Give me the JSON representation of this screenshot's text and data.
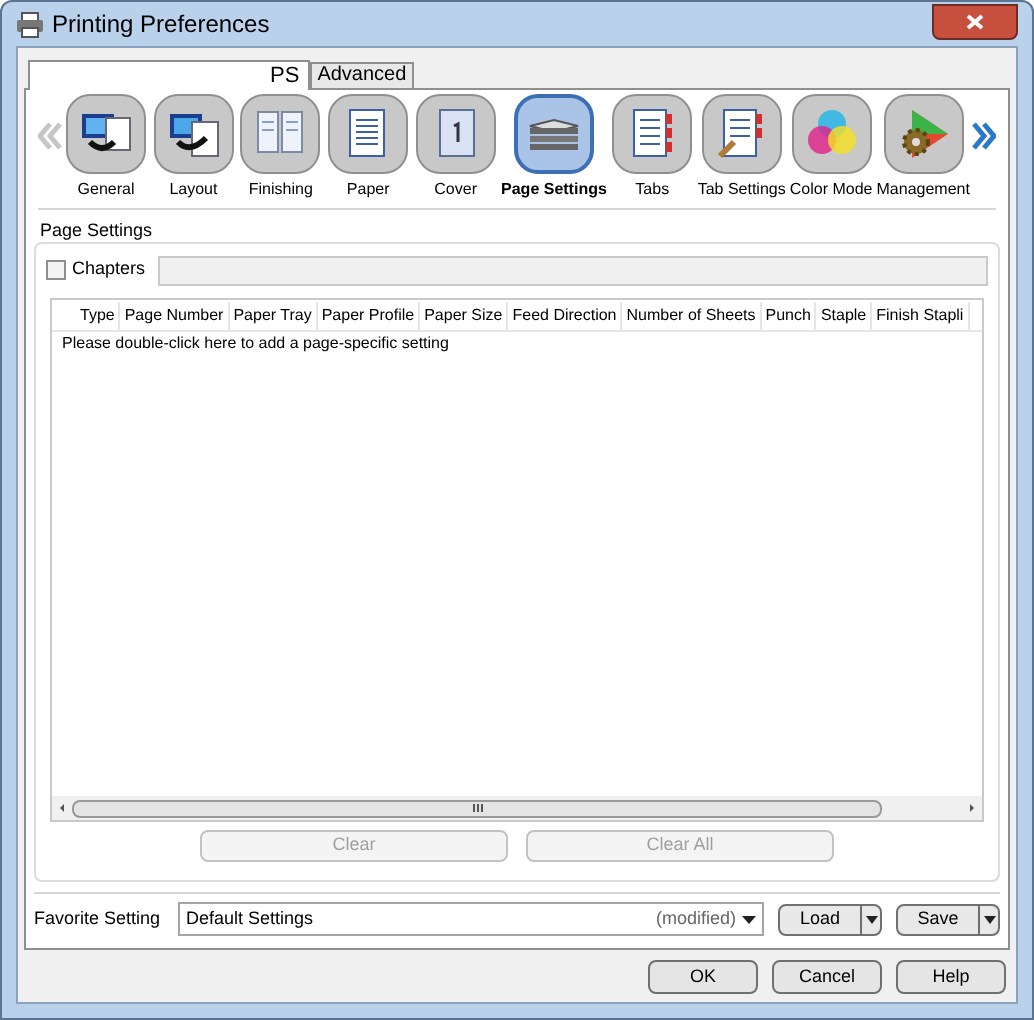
{
  "window": {
    "title": "Printing Preferences"
  },
  "tabs": [
    {
      "label": "PS",
      "selected": true
    },
    {
      "label": "Advanced",
      "selected": false
    }
  ],
  "scroll_left": {
    "disabled": true
  },
  "scroll_right": {
    "disabled": false
  },
  "categories": [
    {
      "label": "General",
      "kind": "monitor",
      "selected": false
    },
    {
      "label": "Layout",
      "kind": "monitor-pages",
      "selected": false
    },
    {
      "label": "Finishing",
      "kind": "folded",
      "selected": false
    },
    {
      "label": "Paper",
      "kind": "document",
      "selected": false
    },
    {
      "label": "Cover",
      "kind": "cover",
      "selected": false
    },
    {
      "label": "Page Settings",
      "kind": "stack",
      "selected": true
    },
    {
      "label": "Tabs",
      "kind": "tabs",
      "selected": false
    },
    {
      "label": "Tab Settings",
      "kind": "tabs-tool",
      "selected": false
    },
    {
      "label": "Color Mode",
      "kind": "color",
      "selected": false
    },
    {
      "label": "Management",
      "kind": "gear",
      "selected": false
    }
  ],
  "page_settings": {
    "title": "Page Settings",
    "chapters": {
      "label": "Chapters",
      "checked": false
    },
    "table": {
      "columns": [
        "Type",
        "Page Number",
        "Paper Tray",
        "Paper Profile",
        "Paper Size",
        "Feed Direction",
        "Number of Sheets",
        "Punch",
        "Staple",
        "Finish Stapli"
      ],
      "hint": "Please double-click here to add a page-specific setting"
    },
    "buttons": [
      {
        "label": "Clear",
        "disabled": true
      },
      {
        "label": "Clear All",
        "disabled": true
      }
    ]
  },
  "favorite": {
    "label": "Favorite Setting",
    "value": "Default Settings",
    "note": "(modified)",
    "buttons": [
      "Load",
      "Save"
    ]
  },
  "buttons": [
    "OK",
    "Cancel",
    "Help"
  ]
}
